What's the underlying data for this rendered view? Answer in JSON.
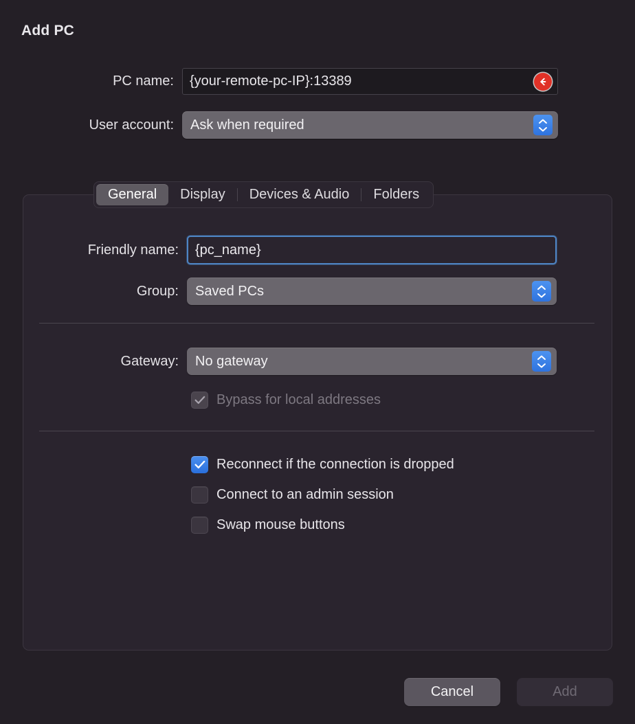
{
  "dialog": {
    "title": "Add PC"
  },
  "top_form": {
    "pc_name": {
      "label": "PC name:",
      "value": "{your-remote-pc-IP}:13389",
      "error_icon": "back-arrow-circle-icon"
    },
    "user_account": {
      "label": "User account:",
      "value": "Ask when required",
      "stepper_icon": "up-down-chevron-icon"
    }
  },
  "tabs": [
    {
      "label": "General",
      "selected": true
    },
    {
      "label": "Display",
      "selected": false
    },
    {
      "label": "Devices & Audio",
      "selected": false
    },
    {
      "label": "Folders",
      "selected": false
    }
  ],
  "general_tab": {
    "friendly_name": {
      "label": "Friendly name:",
      "value": "{pc_name}"
    },
    "group": {
      "label": "Group:",
      "value": "Saved PCs"
    },
    "gateway": {
      "label": "Gateway:",
      "value": "No gateway"
    },
    "bypass": {
      "label": "Bypass for local addresses",
      "checked": true,
      "enabled": false
    },
    "options": [
      {
        "label": "Reconnect if the connection is dropped",
        "checked": true
      },
      {
        "label": "Connect to an admin session",
        "checked": false
      },
      {
        "label": "Swap mouse buttons",
        "checked": false
      }
    ]
  },
  "footer": {
    "cancel_label": "Cancel",
    "add_label": "Add"
  },
  "colors": {
    "window_background": "#241f26",
    "panel_background": "#2a242e",
    "accent_blue": "#2f73df",
    "error_red": "#e03127",
    "selected_tab": "#5e5a61"
  }
}
